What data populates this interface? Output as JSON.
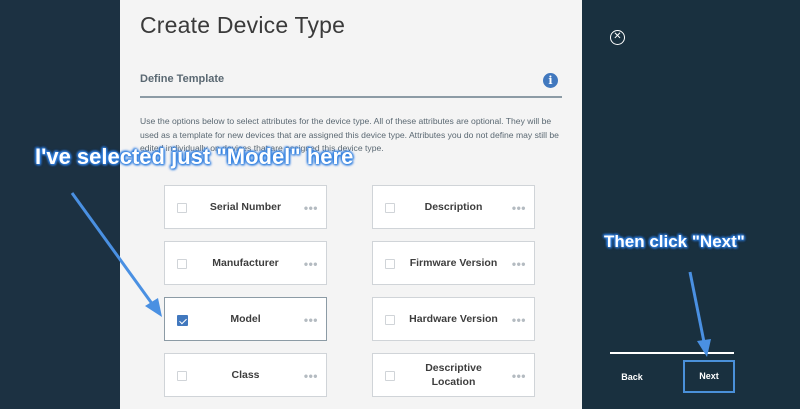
{
  "dialog": {
    "title": "Create Device Type",
    "section_title": "Define Template",
    "description": "Use the options below to select attributes for the device type. All of these attributes are optional. They will be used as a template for new devices that are assigned this device type. Attributes you do not define may still be edited individually on devices that are assigned this device type."
  },
  "options": {
    "serial_number": {
      "label": "Serial Number",
      "checked": false
    },
    "description": {
      "label": "Description",
      "checked": false
    },
    "manufacturer": {
      "label": "Manufacturer",
      "checked": false
    },
    "firmware_version": {
      "label": "Firmware Version",
      "checked": false
    },
    "model": {
      "label": "Model",
      "checked": true
    },
    "hardware_version": {
      "label": "Hardware Version",
      "checked": false
    },
    "class": {
      "label": "Class",
      "checked": false
    },
    "descriptive_location": {
      "label": "Descriptive Location",
      "checked": false
    },
    "more_glyph": "•••"
  },
  "nav": {
    "close_glyph": "✕",
    "back_label": "Back",
    "next_label": "Next"
  },
  "annotations": {
    "selected_note": "I've selected just \"Model\" here",
    "next_note": "Then click \"Next\"",
    "color": "#2f7fe0"
  },
  "colors": {
    "accent": "#4178be",
    "background": "#1f3a4d"
  }
}
